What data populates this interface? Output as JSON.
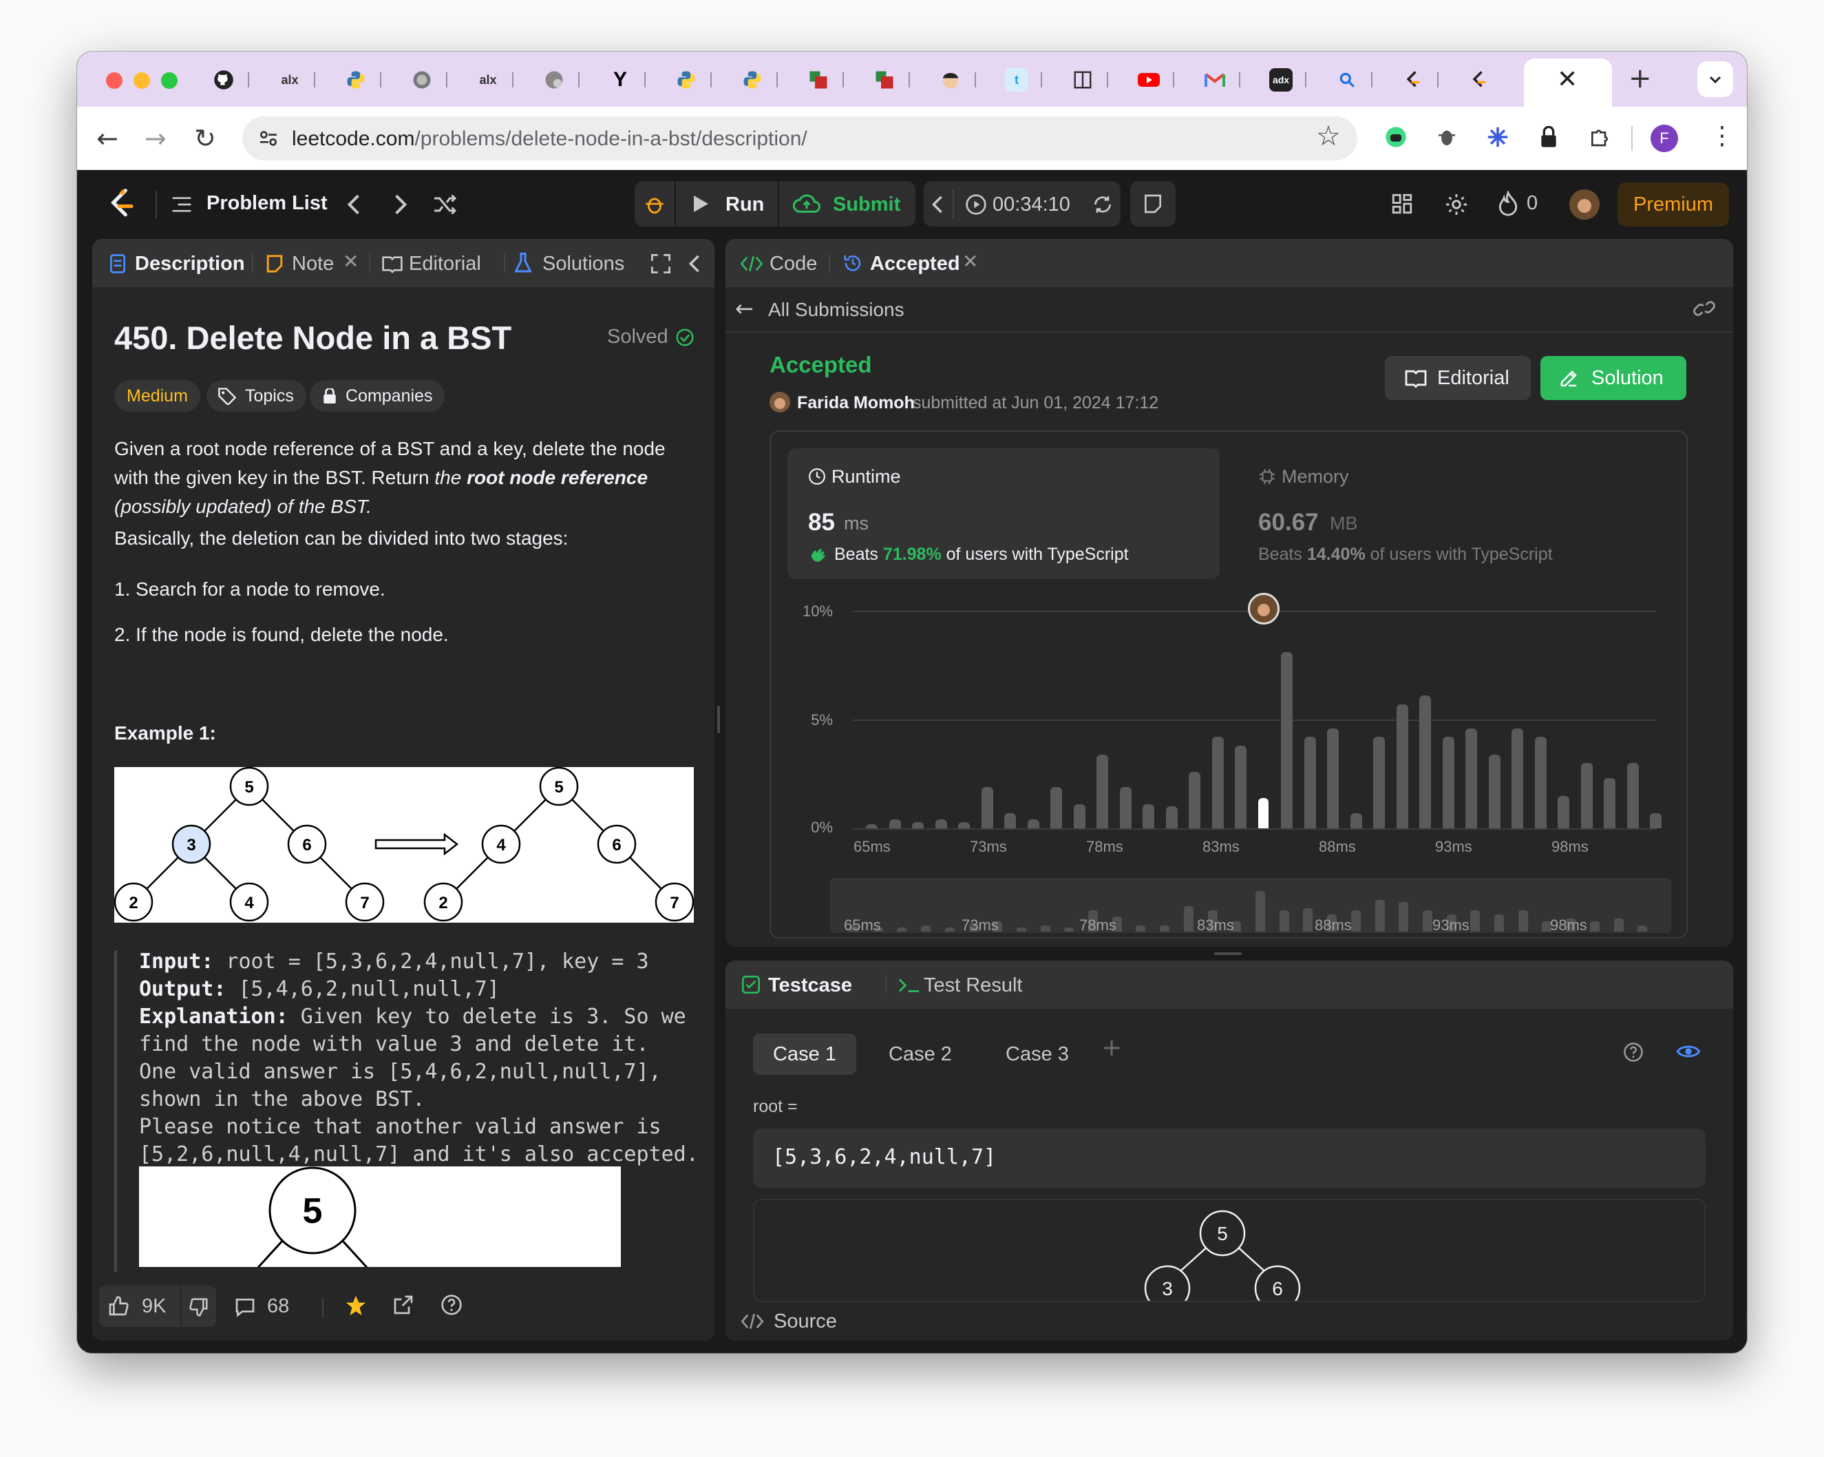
{
  "browser": {
    "url_host": "leetcode.com",
    "url_path": "/problems/delete-node-in-a-bst/description/",
    "tab_icons": [
      "github-icon",
      "alx-icon",
      "python-icon",
      "globe-icon",
      "alx-icon",
      "globe-icon",
      "ycombinator-icon",
      "python-icon",
      "python-icon",
      "puzzle-icon",
      "puzzle-icon",
      "avatar-icon",
      "tumblr-icon",
      "book-icon",
      "youtube-icon",
      "gmail-icon",
      "adx-icon",
      "search-icon",
      "leetcode-icon",
      "leetcode-icon"
    ],
    "profile_initial": "F",
    "tab_glyphs": {
      "alx": "alx",
      "y": "Y",
      "t": "t",
      "adx": "adx"
    }
  },
  "topnav": {
    "problem_list": "Problem List",
    "run": "Run",
    "submit": "Submit",
    "timer": "00:34:10",
    "streak": "0",
    "premium": "Premium"
  },
  "left": {
    "tabs": {
      "description": "Description",
      "note": "Note",
      "editorial": "Editorial",
      "solutions": "Solutions"
    },
    "title": "450. Delete Node in a BST",
    "solved": "Solved",
    "difficulty": "Medium",
    "topics": "Topics",
    "companies": "Companies",
    "desc_1": "Given a root node reference of a BST and a key, delete the node with the given key in the BST. Return ",
    "desc_em": "the ",
    "desc_strong": "root node reference",
    "desc_em2": " (possibly updated) of the BST.",
    "desc_2": "Basically, the deletion can be divided into two stages:",
    "step_1": "1. Search for a node to remove.",
    "step_2": "2. If the node is found, delete the node.",
    "example_title": "Example 1:",
    "input_label": "Input:",
    "input_value": " root = [5,3,6,2,4,null,7], key = 3",
    "output_label": "Output:",
    "output_value": " [5,4,6,2,null,null,7]",
    "explanation_label": "Explanation:",
    "explanation_value": " Given key to delete is 3. So we\nfind the node with value 3 and delete it.\nOne valid answer is [5,4,6,2,null,null,7],\nshown in the above BST.\nPlease notice that another valid answer is\n[5,2,6,null,4,null,7] and it's also accepted.",
    "tree_before": [
      "5",
      "3",
      "6",
      "2",
      "4",
      "7"
    ],
    "tree_after": [
      "5",
      "4",
      "6",
      "2",
      "7"
    ],
    "big_node": "5",
    "likes": "9K",
    "comments": "68"
  },
  "right": {
    "tab_code": "Code",
    "tab_accepted": "Accepted",
    "all_submissions": "All Submissions",
    "status": "Accepted",
    "author": "Farida Momoh",
    "submitted": "submitted at Jun 01, 2024 17:12",
    "editorial_btn": "Editorial",
    "solution_btn": "Solution",
    "runtime": {
      "label": "Runtime",
      "value": "85",
      "unit": "ms",
      "beats_prefix": "Beats",
      "beats": "71.98%",
      "beats_suffix": "of users with TypeScript"
    },
    "memory": {
      "label": "Memory",
      "value": "60.67",
      "unit": "MB",
      "beats_prefix": "Beats",
      "beats": "14.40%",
      "beats_suffix": "of users with TypeScript"
    }
  },
  "chart_data": {
    "type": "bar",
    "title": "",
    "ylabel": "",
    "yticks": [
      "10%",
      "5%",
      "0%"
    ],
    "ylim": [
      0,
      10
    ],
    "xticks": [
      "65ms",
      "73ms",
      "78ms",
      "83ms",
      "88ms",
      "93ms",
      "98ms"
    ],
    "highlight_index": 17,
    "values": [
      0.2,
      0.4,
      0.3,
      0.4,
      0.3,
      1.9,
      0.7,
      0.4,
      1.9,
      1.1,
      3.4,
      1.9,
      1.1,
      1.0,
      2.6,
      4.2,
      3.8,
      1.4,
      8.1,
      4.2,
      4.6,
      0.7,
      4.2,
      5.7,
      6.1,
      4.2,
      4.6,
      3.4,
      4.6,
      4.2,
      1.5,
      3.0,
      2.3,
      3.0,
      0.7
    ],
    "mini_values": [
      0.3,
      0.2,
      0.2,
      0.3,
      0.2,
      0.4,
      0.5,
      0.2,
      0.3,
      0.2,
      1.0,
      0.7,
      0.3,
      0.3,
      1.2,
      1.0,
      0.5,
      1.9,
      1.0,
      1.1,
      0.8,
      1.0,
      1.5,
      1.4,
      1.0,
      0.8,
      1.0,
      0.8,
      1.0,
      0.5,
      0.6,
      0.5,
      0.6,
      0.3
    ]
  },
  "testcase": {
    "tab_testcase": "Testcase",
    "tab_result": "Test Result",
    "cases": [
      "Case 1",
      "Case 2",
      "Case 3"
    ],
    "param": "root =",
    "value": "[5,3,6,2,4,null,7]",
    "preview_nodes": [
      "5",
      "3",
      "6"
    ],
    "source": "Source"
  }
}
